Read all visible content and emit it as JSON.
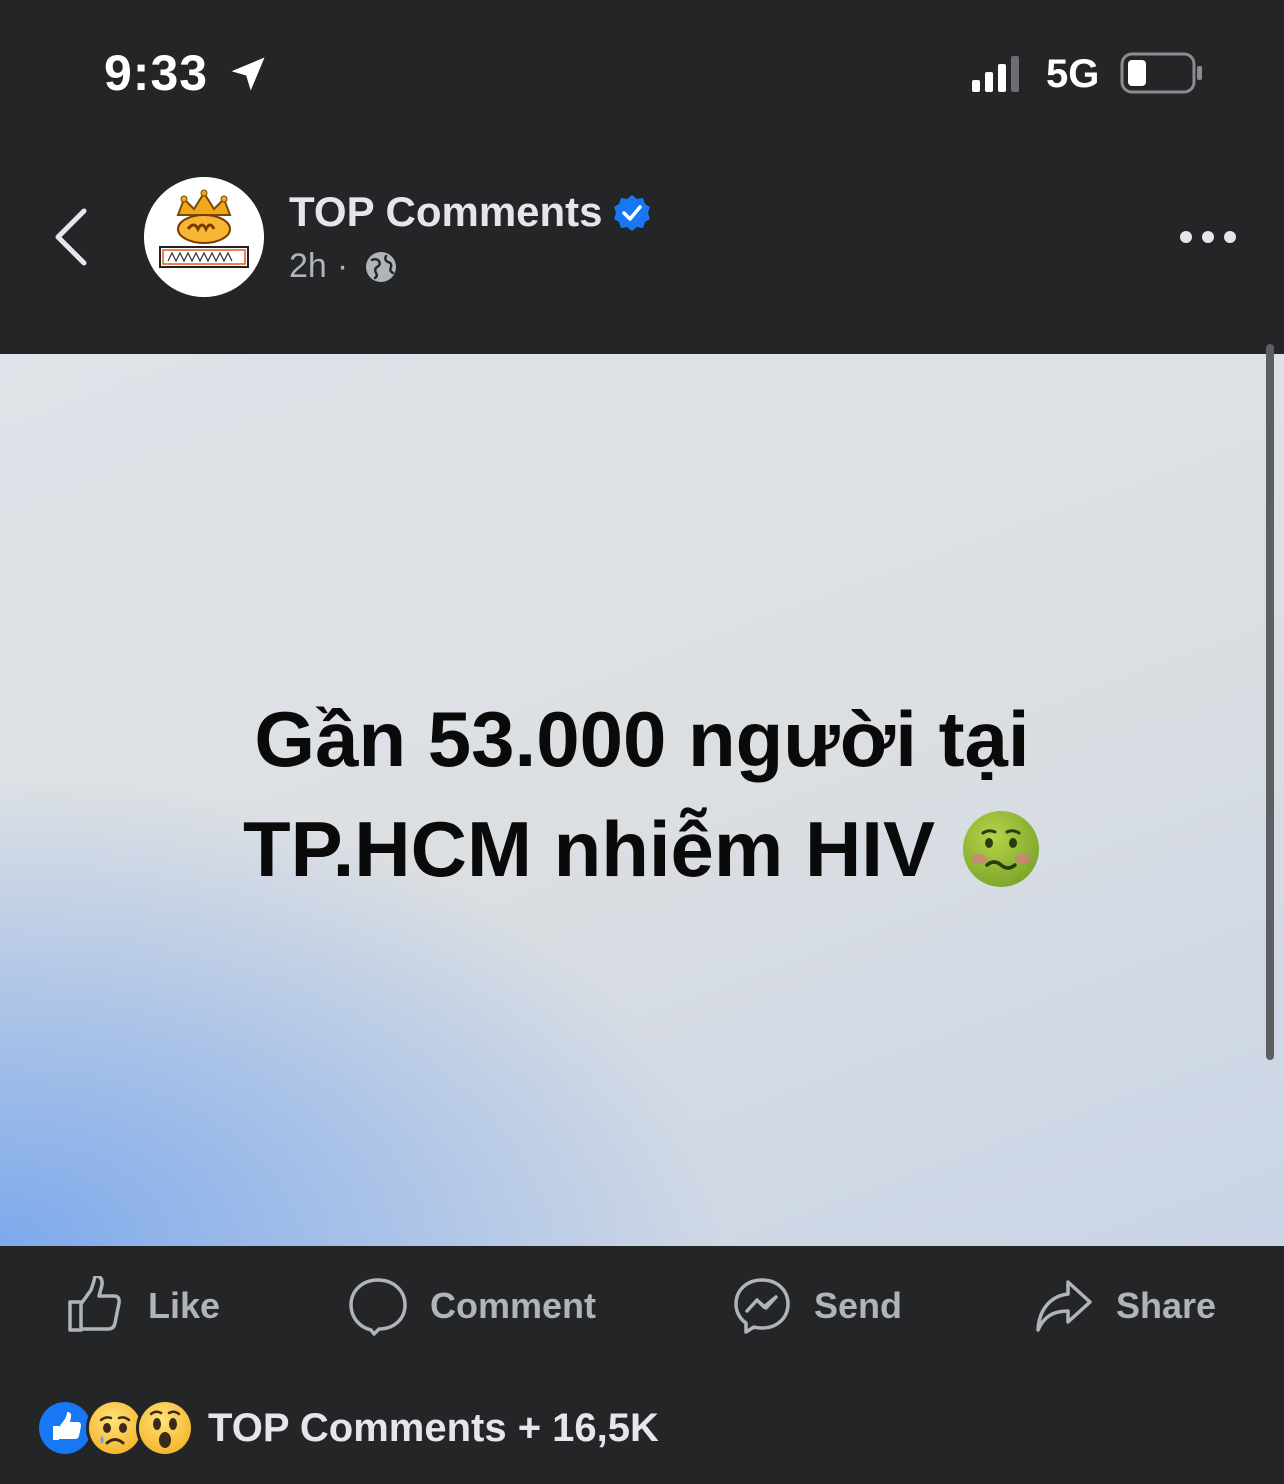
{
  "status_bar": {
    "time": "9:33",
    "network": "5G",
    "icons": [
      "location-arrow-icon",
      "signal-bars-icon",
      "battery-icon"
    ]
  },
  "post": {
    "page_name": "TOP Comments",
    "time_ago": "2h",
    "separator": "·",
    "privacy_icon": "globe-icon",
    "avatar_icon": "top-comments-logo",
    "text_line1": "Gần 53.000 người tại",
    "text_line2": "TP.HCM nhiễm HIV",
    "text_emoji": "nauseated-face-emoji"
  },
  "actions": {
    "like": "Like",
    "comment": "Comment",
    "send": "Send",
    "share": "Share"
  },
  "reactions": {
    "icons": [
      "like-reaction-icon",
      "sad-reaction-icon",
      "wow-reaction-icon"
    ],
    "summary": "TOP Comments + 16,5K"
  },
  "colors": {
    "background": "#242526",
    "text_primary": "#e4e6eb",
    "text_secondary": "#b0b3b8",
    "verified_blue": "#1877f2"
  }
}
